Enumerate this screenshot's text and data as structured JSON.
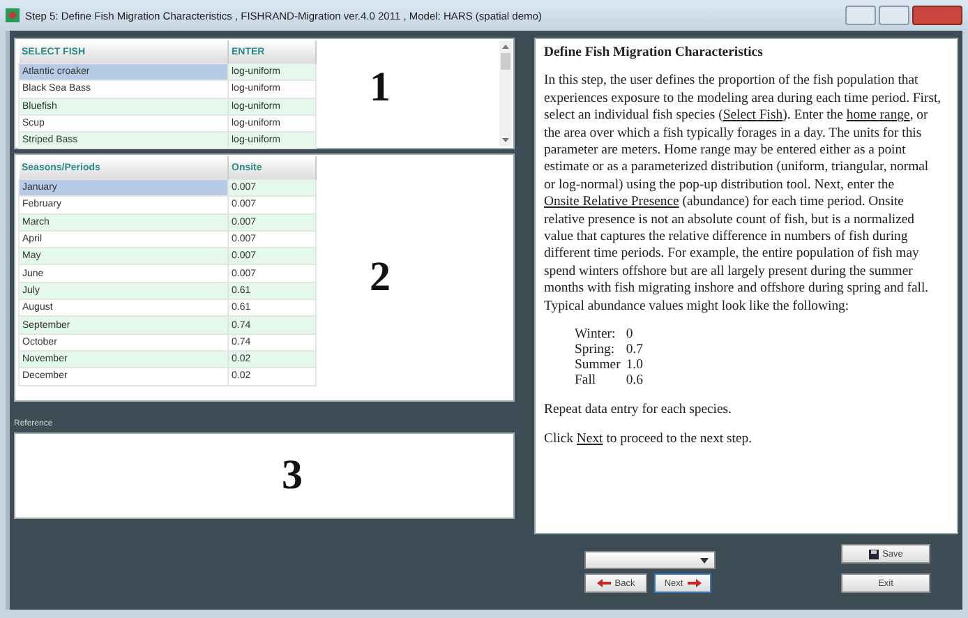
{
  "window": {
    "title": "Step 5: Define Fish Migration Characteristics , FISHRAND-Migration ver.4.0 2011 , Model: HARS (spatial demo)"
  },
  "fish_table": {
    "columns": [
      "SELECT FISH",
      "ENTER"
    ],
    "rows": [
      {
        "cells": [
          "Atlantic croaker",
          "log-uniform"
        ],
        "selected": true
      },
      {
        "cells": [
          "Black Sea Bass",
          "log-uniform"
        ],
        "selected": false
      },
      {
        "cells": [
          "Bluefish",
          "log-uniform"
        ],
        "selected": false
      },
      {
        "cells": [
          "Scup",
          "log-uniform"
        ],
        "selected": false
      },
      {
        "cells": [
          "Striped Bass",
          "log-uniform"
        ],
        "selected": false
      }
    ],
    "annotation": "1"
  },
  "season_table": {
    "columns": [
      "Seasons/Periods",
      "Onsite"
    ],
    "rows": [
      {
        "cells": [
          "January",
          "0.007"
        ],
        "selected": true
      },
      {
        "cells": [
          "February",
          "0.007"
        ],
        "selected": false
      },
      {
        "cells": [
          "March",
          "0.007"
        ],
        "selected": false
      },
      {
        "cells": [
          "April",
          "0.007"
        ],
        "selected": false
      },
      {
        "cells": [
          "May",
          "0.007"
        ],
        "selected": false
      },
      {
        "cells": [
          "June",
          "0.007"
        ],
        "selected": false
      },
      {
        "cells": [
          "July",
          "0.61"
        ],
        "selected": false
      },
      {
        "cells": [
          "August",
          "0.61"
        ],
        "selected": false
      },
      {
        "cells": [
          "September",
          "0.74"
        ],
        "selected": false
      },
      {
        "cells": [
          "October",
          "0.74"
        ],
        "selected": false
      },
      {
        "cells": [
          "November",
          "0.02"
        ],
        "selected": false
      },
      {
        "cells": [
          "December",
          "0.02"
        ],
        "selected": false
      }
    ],
    "annotation": "2"
  },
  "reference": {
    "label": "Reference",
    "annotation": "3"
  },
  "help": {
    "title": "Define Fish Migration Characteristics",
    "paragraphs": [
      [
        {
          "text": "In this step, the user defines the proportion of the fish population that experiences exposure to the modeling area during each time period. First, select an individual fish species (",
          "link": false
        },
        {
          "text": "Select Fish",
          "link": true
        },
        {
          "text": ").  Enter the ",
          "link": false
        },
        {
          "text": "home range",
          "link": true
        },
        {
          "text": ", or the area over which a fish typically forages in a day.  The units for this parameter are meters.   Home range may be entered either as a point estimate or as a parameterized distribution (uniform, triangular, normal or log-normal) using the pop-up distribution tool. Next, enter the ",
          "link": false
        },
        {
          "text": "Onsite Relative Presence",
          "link": true
        },
        {
          "text": " (abundance) for each time period.  Onsite relative presence is not an absolute count of fish, but is a normalized value that captures the relative difference in numbers of fish during different time periods.  For example, the entire population of fish may spend winters offshore but are all largely present during the summer months with fish migrating inshore and offshore during spring and fall.  Typical abundance values might look like the following:",
          "link": false
        }
      ]
    ],
    "examples": [
      {
        "season": "Winter:",
        "value": "0"
      },
      {
        "season": "Spring:",
        "value": "0.7"
      },
      {
        "season": "Summer",
        "value": "1.0"
      },
      {
        "season": "Fall",
        "value": "0.6"
      }
    ],
    "closing": [
      [
        {
          "text": "Repeat data entry for each species.",
          "link": false
        }
      ],
      [
        {
          "text": "Click ",
          "link": false
        },
        {
          "text": "Next",
          "link": true
        },
        {
          "text": " to proceed to the next step.",
          "link": false
        }
      ]
    ]
  },
  "buttons": {
    "back": "Back",
    "next": "Next",
    "save": "Save",
    "exit": "Exit"
  }
}
